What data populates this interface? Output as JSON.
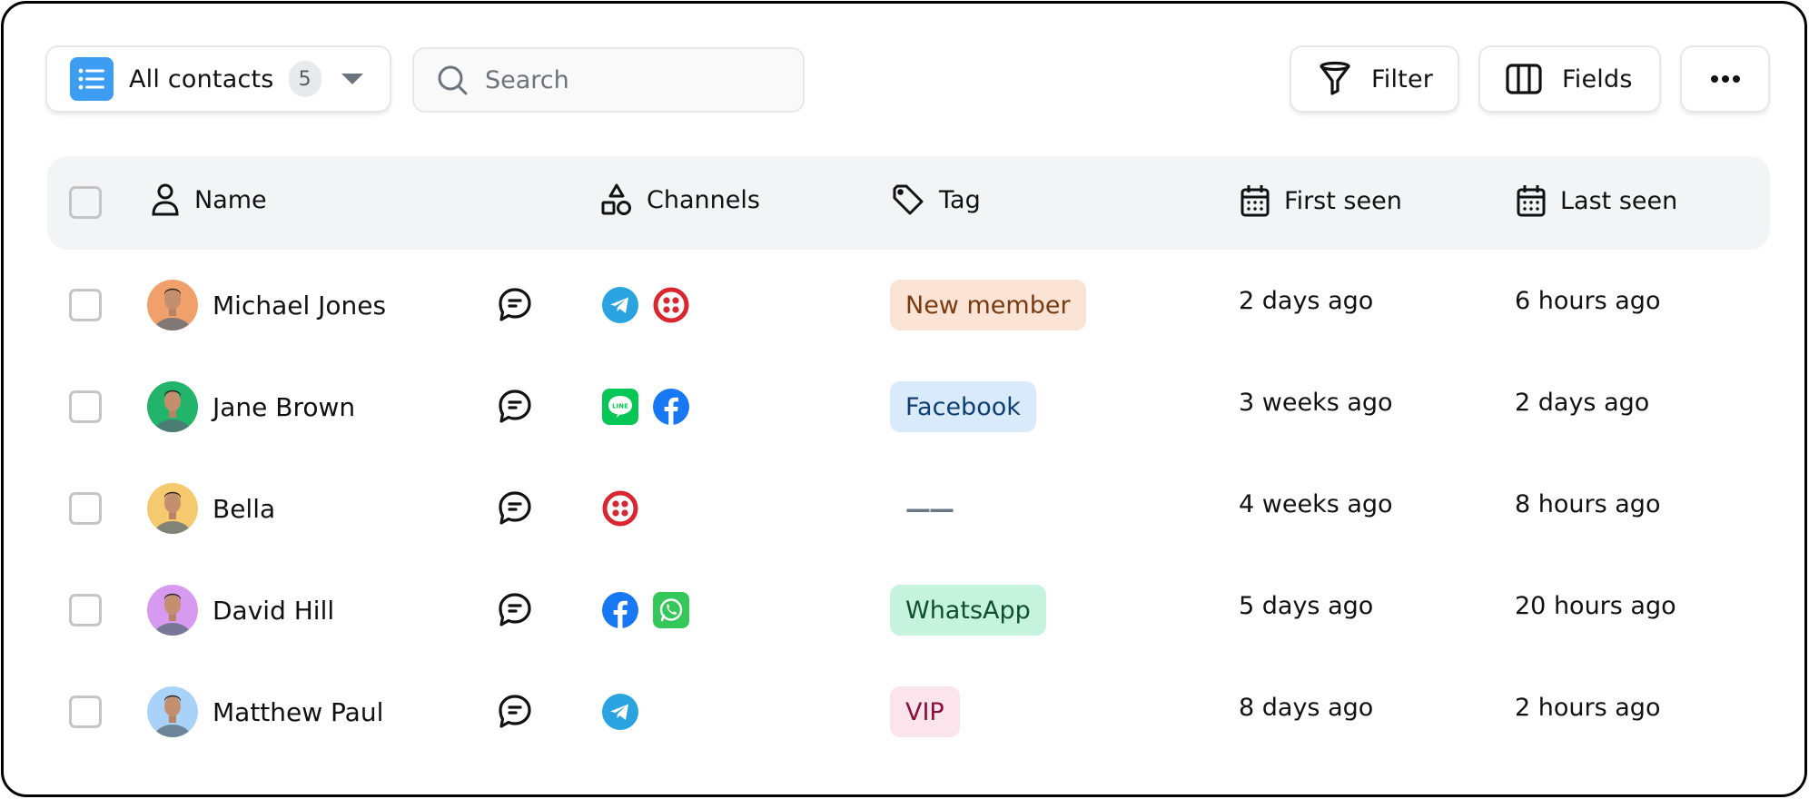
{
  "toolbar": {
    "view_label": "All contacts",
    "view_count": "5",
    "search_placeholder": "Search",
    "search_value": "",
    "filter_label": "Filter",
    "fields_label": "Fields",
    "more_label": "•••"
  },
  "table": {
    "columns": {
      "name": "Name",
      "channels": "Channels",
      "tag": "Tag",
      "first_seen": "First seen",
      "last_seen": "Last seen"
    },
    "rows": [
      {
        "name": "Michael Jones",
        "avatar_bg": "#f0a06a",
        "channels": [
          "telegram",
          "twilio"
        ],
        "tag": "New member",
        "tag_bg": "#fbe3d6",
        "tag_color": "#7a3a10",
        "first_seen": "2 days ago",
        "last_seen": "6 hours ago"
      },
      {
        "name": "Jane Brown",
        "avatar_bg": "#22b46a",
        "channels": [
          "line",
          "facebook"
        ],
        "tag": "Facebook",
        "tag_bg": "#d9eafb",
        "tag_color": "#0f3f73",
        "first_seen": "3 weeks ago",
        "last_seen": "2 days ago"
      },
      {
        "name": "Bella",
        "avatar_bg": "#f5c96e",
        "channels": [
          "twilio"
        ],
        "tag": "——",
        "tag_bg": "",
        "tag_color": "#6b7785",
        "first_seen": "4 weeks ago",
        "last_seen": "8 hours ago"
      },
      {
        "name": "David Hill",
        "avatar_bg": "#d69af0",
        "channels": [
          "facebook",
          "whatsapp"
        ],
        "tag": "WhatsApp",
        "tag_bg": "#c6f3dd",
        "tag_color": "#0e4f2e",
        "first_seen": "5 days ago",
        "last_seen": "20 hours ago"
      },
      {
        "name": "Matthew Paul",
        "avatar_bg": "#a8d2f8",
        "channels": [
          "telegram"
        ],
        "tag": "VIP",
        "tag_bg": "#fce4ec",
        "tag_color": "#8a0f3a",
        "first_seen": "8 days ago",
        "last_seen": "2 hours ago"
      }
    ]
  },
  "colors": {
    "accent": "#3d9df2",
    "header_bg": "#f3f4f6",
    "telegram": "#2aa3e0",
    "twilio": "#d9262f",
    "line": "#06c755",
    "facebook": "#1877f2",
    "whatsapp": "#34c759"
  }
}
